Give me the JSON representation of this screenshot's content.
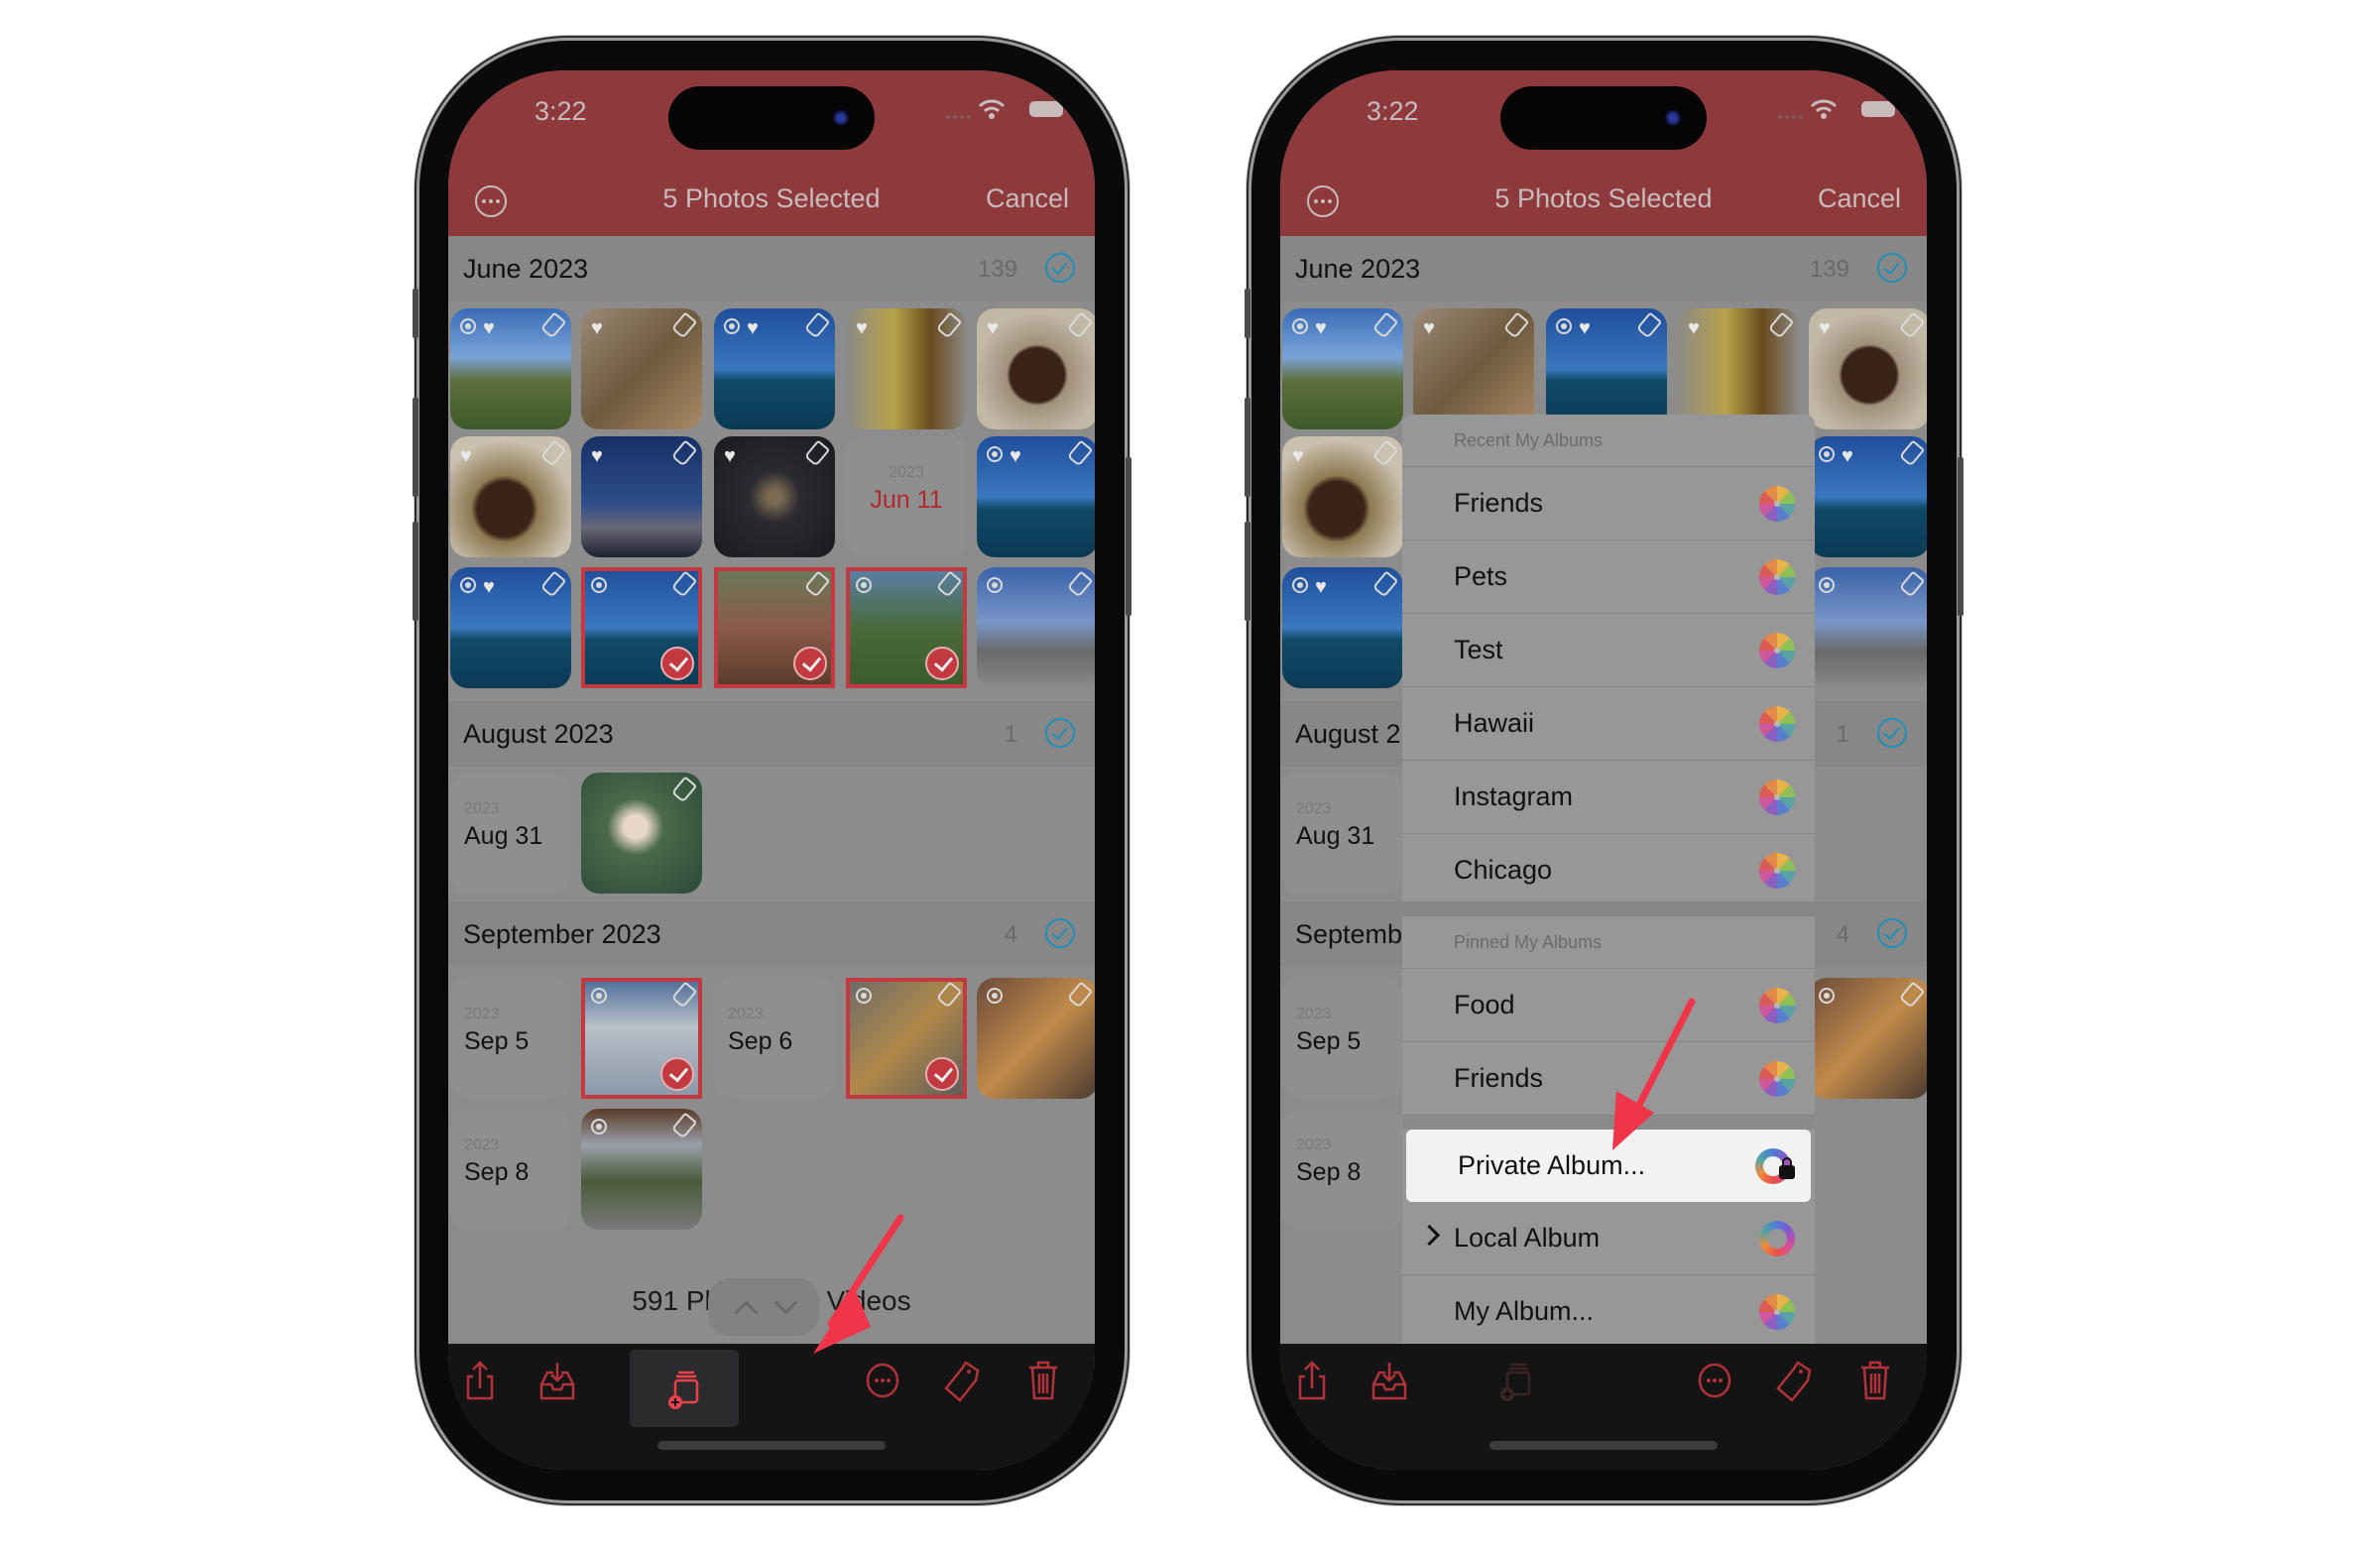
{
  "status_bar": {
    "time": "3:22",
    "icons": [
      "cellular-icon",
      "wifi-icon",
      "battery-icon"
    ]
  },
  "nav": {
    "more_icon": "ellipsis-circle-icon",
    "title": "5 Photos Selected",
    "cancel_label": "Cancel"
  },
  "colors": {
    "header": "#8e3a3c",
    "accent_red": "#c2393f",
    "check_blue": "#1e8fb6",
    "toolbar": "#151415",
    "annotation_arrow": "#f0354a"
  },
  "sections": [
    {
      "title": "June 2023",
      "count": "139",
      "date_cell": {
        "year": "2023",
        "date": "Jun 11"
      }
    },
    {
      "title": "August 2023",
      "count": "1",
      "date_cell": {
        "year": "2023",
        "date": "Aug 31"
      }
    },
    {
      "title": "September 2023",
      "count": "4",
      "date_cells": [
        {
          "year": "2023",
          "date": "Sep 5"
        },
        {
          "year": "2023",
          "date": "Sep 6"
        },
        {
          "year": "2023",
          "date": "Sep 8"
        }
      ]
    }
  ],
  "right_phone_sections": [
    {
      "title": "June 2023",
      "count": "139"
    },
    {
      "title": "August 2",
      "count": "1"
    },
    {
      "title": "Septemb",
      "count": "4"
    }
  ],
  "photos": {
    "june": [
      {
        "subject": "mountain",
        "live": true,
        "favorite": true,
        "selected": false
      },
      {
        "subject": "burger",
        "live": false,
        "favorite": true,
        "selected": false
      },
      {
        "subject": "ocean",
        "live": true,
        "favorite": true,
        "selected": false
      },
      {
        "subject": "beer",
        "live": false,
        "favorite": true,
        "selected": false
      },
      {
        "subject": "dessert",
        "live": false,
        "favorite": true,
        "selected": false
      },
      {
        "subject": "dessert-plate",
        "live": false,
        "favorite": true,
        "selected": false
      },
      {
        "subject": "sunset",
        "live": false,
        "favorite": true,
        "selected": false
      },
      {
        "subject": "fireworks",
        "live": false,
        "favorite": true,
        "selected": false
      },
      {
        "subject": "ocean",
        "live": true,
        "favorite": true,
        "selected": false
      },
      {
        "subject": "ocean",
        "live": true,
        "favorite": true,
        "selected": false
      },
      {
        "subject": "ocean",
        "live": true,
        "favorite": false,
        "selected": true
      },
      {
        "subject": "dessert-spoon",
        "live": false,
        "favorite": false,
        "selected": true
      },
      {
        "subject": "palm-trees",
        "live": true,
        "favorite": false,
        "selected": true
      },
      {
        "subject": "airport",
        "live": true,
        "favorite": false,
        "selected": false
      }
    ],
    "august": [
      {
        "subject": "water-lily",
        "live": false,
        "favorite": false,
        "selected": false
      }
    ],
    "september": [
      {
        "subject": "clouds",
        "live": true,
        "favorite": false,
        "selected": true
      },
      {
        "subject": "cat",
        "live": true,
        "favorite": false,
        "selected": true
      },
      {
        "subject": "cat-lying",
        "live": true,
        "favorite": false,
        "selected": false
      },
      {
        "subject": "pavilion",
        "live": true,
        "favorite": false,
        "selected": false
      }
    ]
  },
  "footer": {
    "summary_text": "591 Photos, 14 Videos",
    "visible_text_left": "591 Ph",
    "visible_text_right": "Videos"
  },
  "toolbar": {
    "items": [
      {
        "name": "share-icon"
      },
      {
        "name": "import-tray-icon"
      },
      {
        "name": "add-to-album-icon",
        "active_left": true
      },
      {
        "name": "more-ellipsis-icon"
      },
      {
        "name": "tag-icon"
      },
      {
        "name": "trash-icon"
      }
    ]
  },
  "album_menu": {
    "recent_header": "Recent My Albums",
    "recent_items": [
      "Friends",
      "Pets",
      "Test",
      "Hawaii",
      "Instagram",
      "Chicago"
    ],
    "pinned_header": "Pinned My Albums",
    "pinned_items": [
      "Food",
      "Friends"
    ],
    "actions": [
      {
        "label": "Private Album...",
        "icon": "private-album-lock-icon",
        "highlighted": true
      },
      {
        "label": "Local Album",
        "icon": "local-album-ring-icon",
        "has_chevron": true
      },
      {
        "label": "My Album...",
        "icon": "photos-flower-icon"
      }
    ]
  }
}
